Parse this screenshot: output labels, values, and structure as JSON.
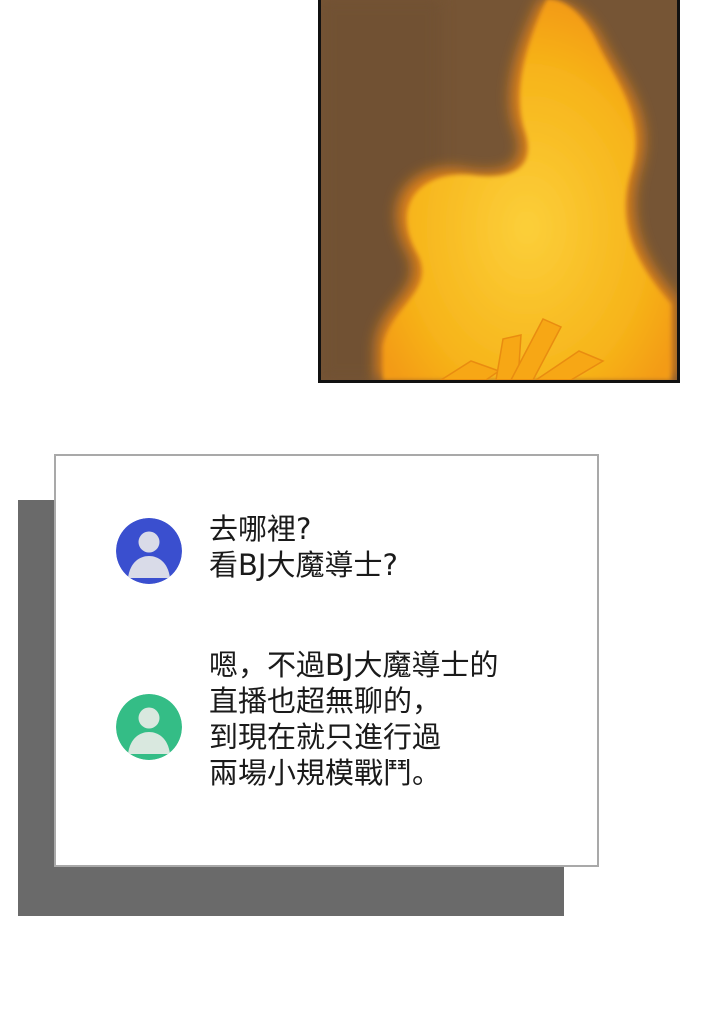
{
  "panel": {
    "illustration": "flame-over-brown-background"
  },
  "chat": {
    "messages": [
      {
        "avatar": "user-avatar-icon",
        "avatar_color": "#3a4fcf",
        "lines": [
          "去哪裡?",
          "看BJ大魔導士?"
        ]
      },
      {
        "avatar": "user-avatar-icon",
        "avatar_color": "#34bd86",
        "lines": [
          "嗯，不過BJ大魔導士的",
          "直播也超無聊的，",
          "到現在就只進行過",
          "兩場小規模戰鬥。"
        ]
      }
    ]
  },
  "colors": {
    "box_border": "#a9a9a9",
    "box_shadow": "#6a6a6a",
    "flame": "#f6b114",
    "flame_glow": "#f08a14",
    "background_brown": "#7a5838"
  }
}
